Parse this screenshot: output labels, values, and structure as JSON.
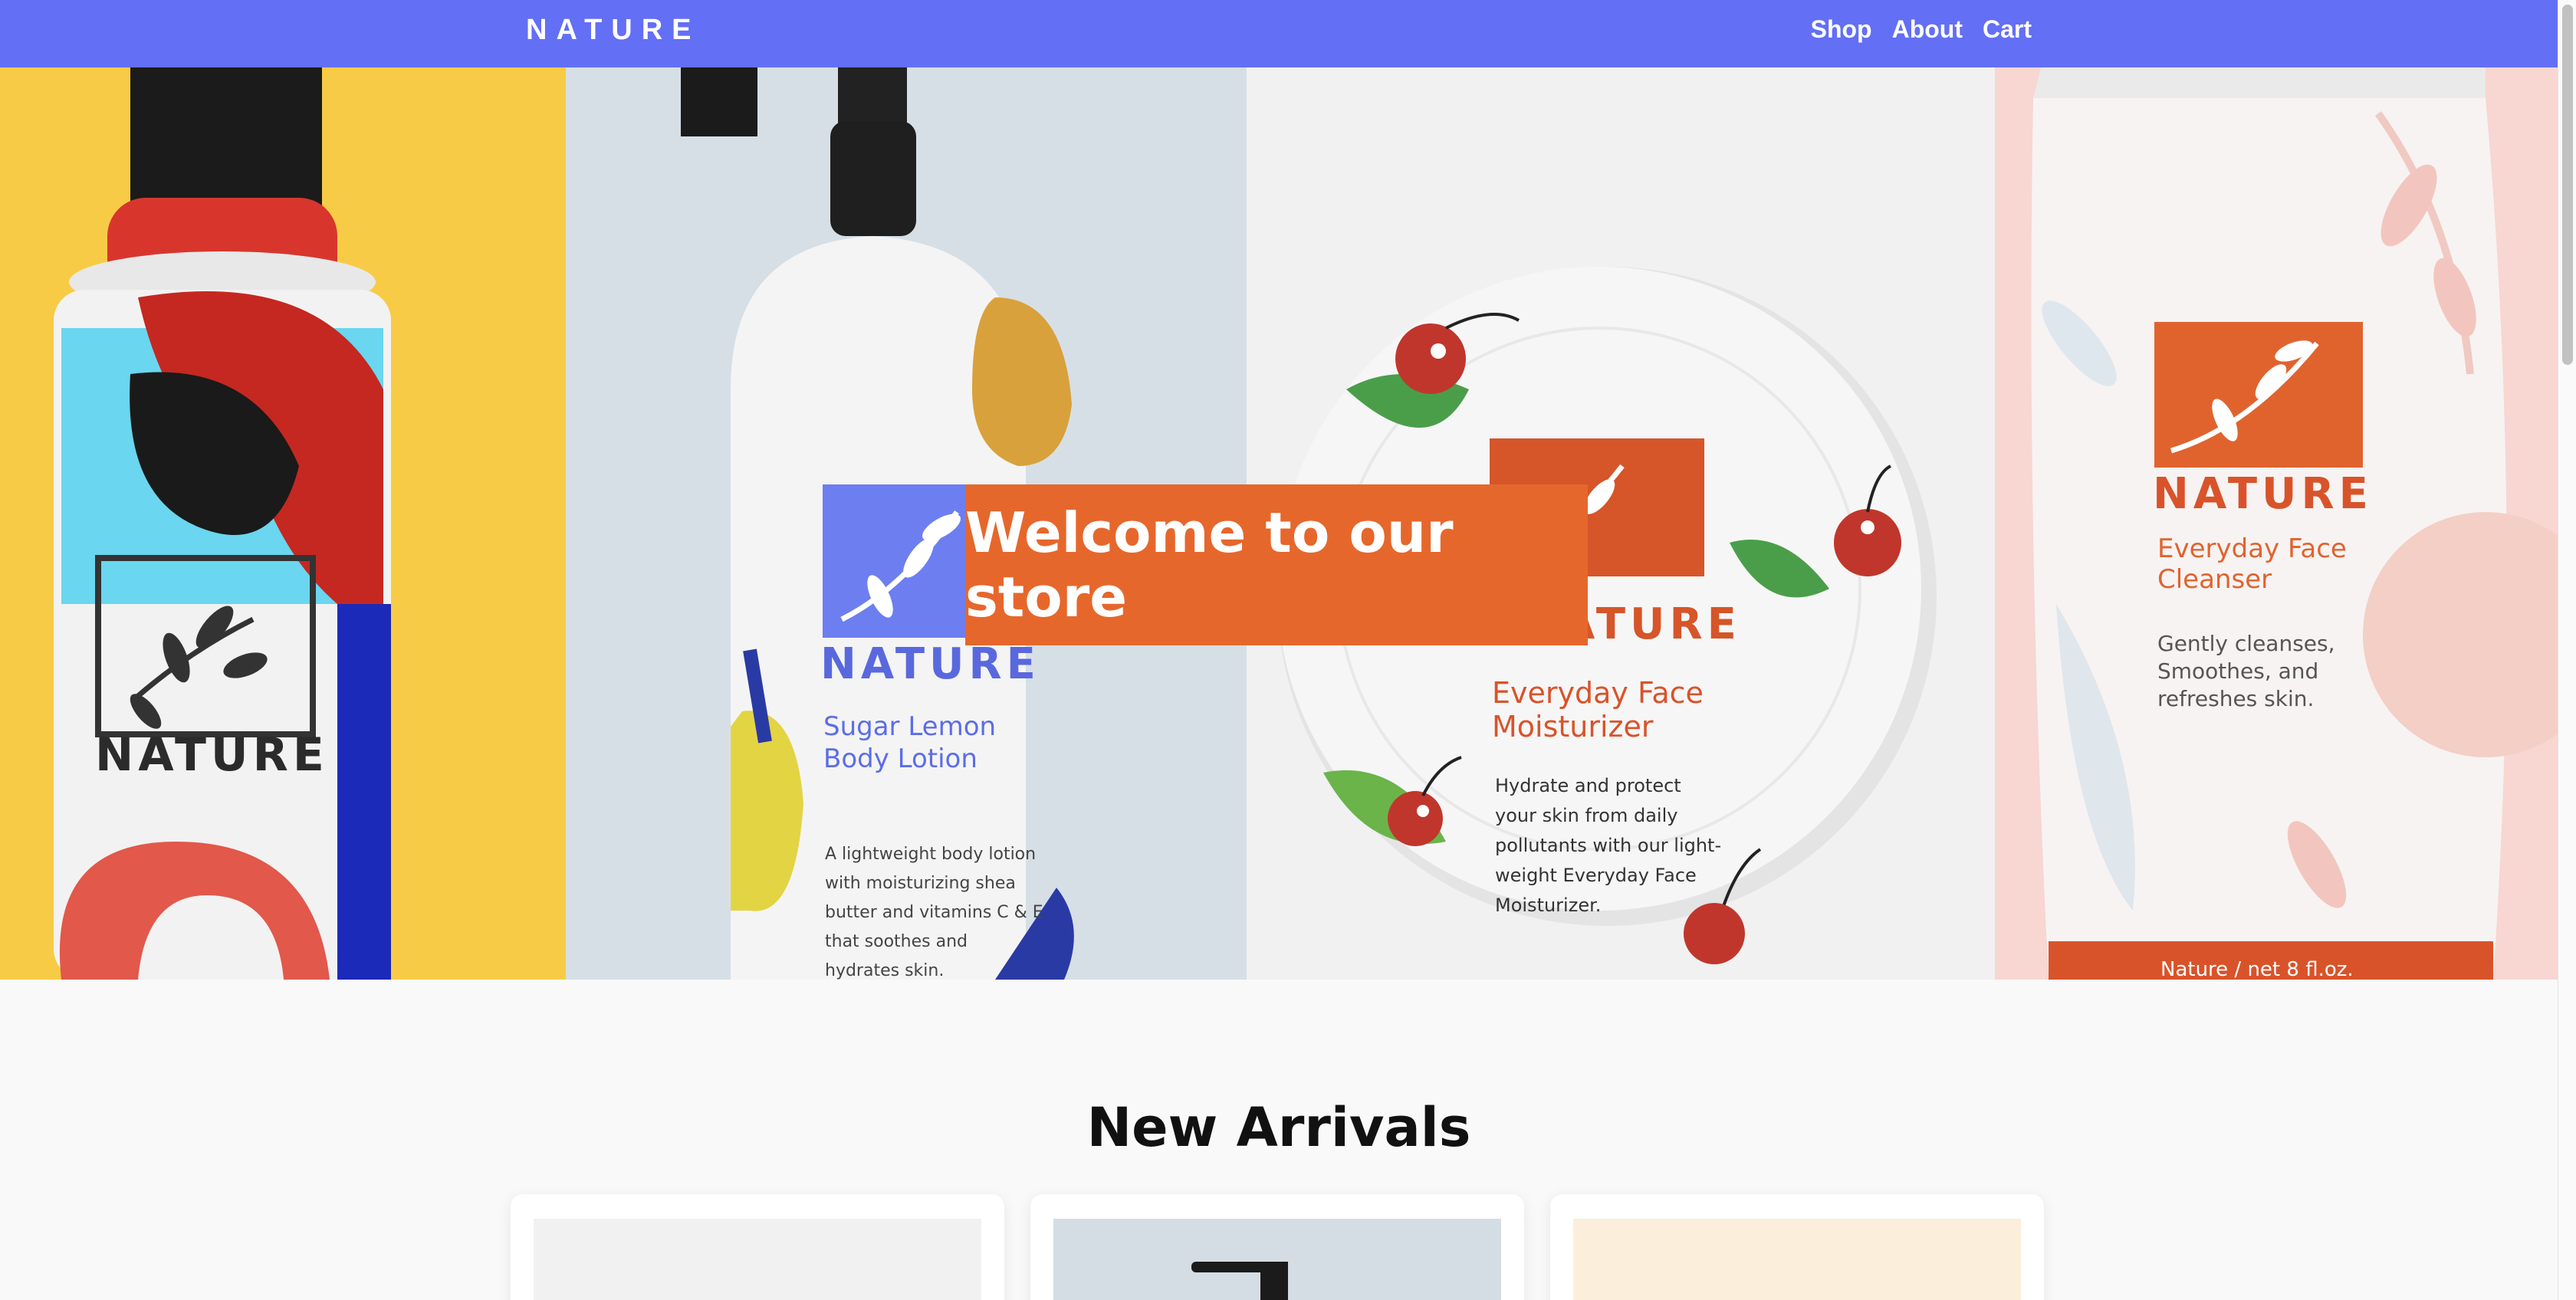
{
  "nav": {
    "brand": "NATURE",
    "links": [
      "Shop",
      "About",
      "Cart"
    ]
  },
  "hero": {
    "welcome": "Welcome to our store",
    "products": [
      {
        "brand": "NATURE"
      },
      {
        "brand": "NATURE",
        "name_line1": "Sugar Lemon",
        "name_line2": "Body Lotion",
        "desc": [
          "A lightweight body lotion",
          "with moisturizing shea",
          "butter and vitamins C & E",
          "that soothes and",
          "hydrates skin."
        ]
      },
      {
        "brand": "NATURE",
        "name_line1": "Everyday Face",
        "name_line2": "Moisturizer",
        "desc": [
          "Hydrate and protect",
          "your skin from daily",
          "pollutants with our light-",
          "weight Everyday Face",
          "Moisturizer."
        ]
      },
      {
        "brand": "NATURE",
        "name_line1": "Everyday Face",
        "name_line2": "Cleanser",
        "desc": [
          "Gently cleanses,",
          "Smoothes, and",
          "refreshes skin."
        ],
        "footer": "Nature / net 8 fl.oz."
      }
    ]
  },
  "arrivals": {
    "title": "New Arrivals"
  },
  "colors": {
    "nav": "#636ff5",
    "accent": "#e6672c",
    "yellow": "#f7cb45",
    "blue_label": "#5c6de8",
    "orange_label": "#d9532a"
  }
}
